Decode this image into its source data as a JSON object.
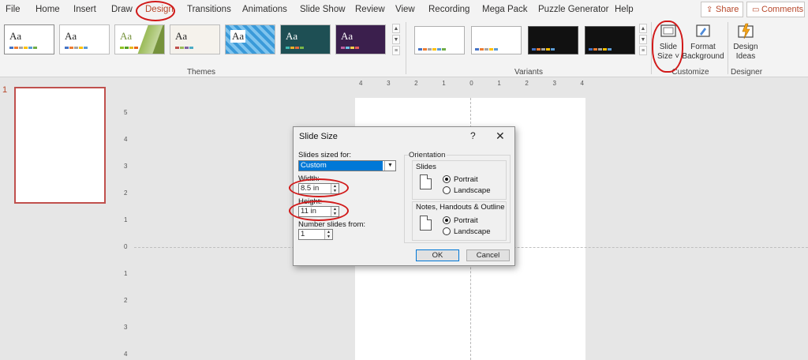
{
  "tabs": [
    "File",
    "Home",
    "Insert",
    "Draw",
    "Design",
    "Transitions",
    "Animations",
    "Slide Show",
    "Review",
    "View",
    "Recording",
    "Mega Pack",
    "Puzzle Generator",
    "Help"
  ],
  "share": {
    "label": "Share",
    "icon": "share-icon"
  },
  "comments": {
    "label": "Comments",
    "icon": "comment-icon"
  },
  "themes": {
    "group_label": "Themes",
    "tile_text": "Aa"
  },
  "variants": {
    "group_label": "Variants"
  },
  "customize": {
    "group_label": "Customize",
    "slide_size": "Slide Size",
    "format_background": "Format Background"
  },
  "designer": {
    "group_label": "Designer",
    "design_ideas": "Design Ideas"
  },
  "slides_pane": {
    "slide_number": "1"
  },
  "ruler": {
    "horizontal": [
      "4",
      "3",
      "2",
      "1",
      "0",
      "1",
      "2",
      "3",
      "4"
    ],
    "vertical": [
      "5",
      "4",
      "3",
      "2",
      "1",
      "0",
      "1",
      "2",
      "3",
      "4"
    ]
  },
  "dialog": {
    "title": "Slide Size",
    "help": "?",
    "close": "✕",
    "sized_for_label": "Slides sized for:",
    "sized_for_value": "Custom",
    "width_label": "Width:",
    "width_value": "8.5 in",
    "height_label": "Height:",
    "height_value": "11 in",
    "number_from_label": "Number slides from:",
    "number_from_value": "1",
    "orientation_label": "Orientation",
    "slides_label": "Slides",
    "portrait": "Portrait",
    "landscape": "Landscape",
    "notes_label": "Notes, Handouts & Outline",
    "notes_portrait": "Portrait",
    "notes_landscape": "Landscape",
    "ok": "OK",
    "cancel": "Cancel"
  },
  "colors": {
    "accent": "#b7472a",
    "annotation": "#d11a1a",
    "selection": "#0078d7"
  }
}
